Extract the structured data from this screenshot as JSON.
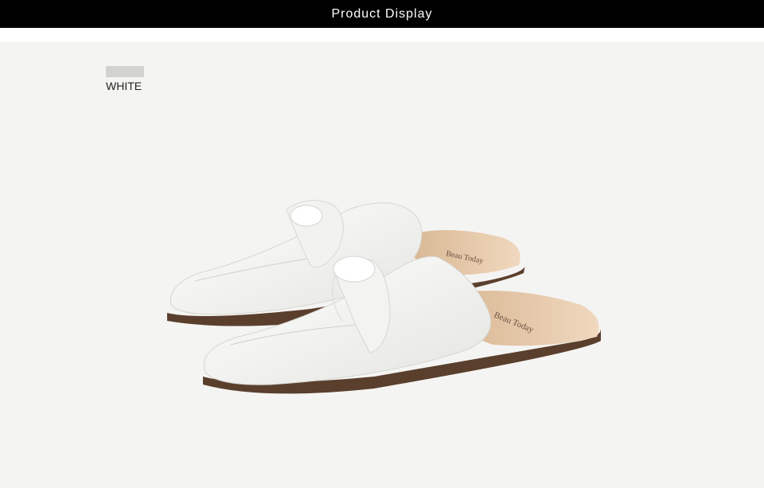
{
  "header": {
    "title": "Product Display"
  },
  "color_option": {
    "label": "WHITE",
    "swatch_color": "#d2d2d1"
  },
  "product": {
    "insole_brand": "Beau Today",
    "colors": {
      "upper": "#f7f7f5",
      "shadow": "#dcdcd8",
      "sole": "#5a3f2c",
      "insole": "#e6c9ab"
    }
  }
}
